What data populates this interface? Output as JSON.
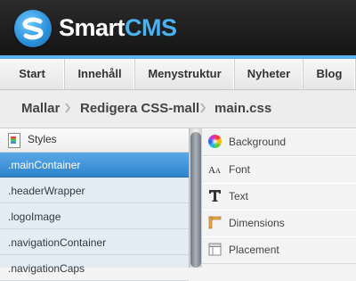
{
  "header": {
    "brand_part1": "Smart",
    "brand_part2": "CMS",
    "logo_icon": "smartcms-s-logo"
  },
  "nav": {
    "items": [
      {
        "label": "Start"
      },
      {
        "label": "Innehåll"
      },
      {
        "label": "Menystruktur"
      },
      {
        "label": "Nyheter"
      },
      {
        "label": "Blog"
      }
    ]
  },
  "breadcrumb": {
    "items": [
      {
        "label": "Mallar"
      },
      {
        "label": "Redigera CSS-mall"
      },
      {
        "label": "main.css"
      }
    ],
    "separator_icon": "chevron-right-icon"
  },
  "styles_panel": {
    "header": "Styles",
    "items": [
      {
        "label": ".mainContainer",
        "selected": true
      },
      {
        "label": ".headerWrapper"
      },
      {
        "label": ".logoImage"
      },
      {
        "label": ".navigationContainer"
      },
      {
        "label": ".navigationCaps"
      }
    ]
  },
  "properties_panel": {
    "items": [
      {
        "label": "Background",
        "icon": "color-wheel-icon"
      },
      {
        "label": "Font",
        "icon": "font-size-icon"
      },
      {
        "label": "Text",
        "icon": "text-icon"
      },
      {
        "label": "Dimensions",
        "icon": "dimensions-icon"
      },
      {
        "label": "Placement",
        "icon": "placement-icon"
      }
    ]
  },
  "colors": {
    "accent": "#5ab2ec",
    "selected_row": "#2e84cc",
    "brand_blue": "#4ab2f0"
  }
}
